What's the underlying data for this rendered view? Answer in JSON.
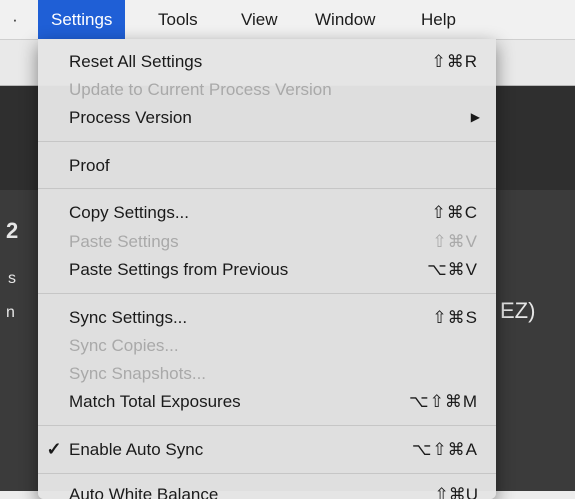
{
  "menubar": {
    "items": [
      {
        "label": "Settings",
        "active": true
      },
      {
        "label": "Tools"
      },
      {
        "label": "View"
      },
      {
        "label": "Window"
      },
      {
        "label": "Help"
      }
    ]
  },
  "background": {
    "frag_a": "2",
    "frag_b": "s",
    "frag_c": "n",
    "frag_d": "EZ)"
  },
  "menu": {
    "items": [
      {
        "label": "Reset All Settings",
        "shortcut": "⇧⌘R",
        "enabled": true
      },
      {
        "label": "Update to Current Process Version",
        "shortcut": "",
        "enabled": false
      },
      {
        "label": "Process Version",
        "submenu": "▶",
        "enabled": true
      },
      {
        "label": "Proof",
        "shortcut": "",
        "enabled": true
      },
      {
        "label": "Copy Settings...",
        "shortcut": "⇧⌘C",
        "enabled": true
      },
      {
        "label": "Paste Settings",
        "shortcut": "⇧⌘V",
        "enabled": false
      },
      {
        "label": "Paste Settings from Previous",
        "shortcut": "⌥⌘V",
        "enabled": true
      },
      {
        "label": "Sync Settings...",
        "shortcut": "⇧⌘S",
        "enabled": true
      },
      {
        "label": "Sync Copies...",
        "shortcut": "",
        "enabled": false
      },
      {
        "label": "Sync Snapshots...",
        "shortcut": "",
        "enabled": false
      },
      {
        "label": "Match Total Exposures",
        "shortcut": "⌥⇧⌘M",
        "enabled": true
      },
      {
        "label": "Enable Auto Sync",
        "shortcut": "⌥⇧⌘A",
        "enabled": true,
        "checked": true,
        "check": "✓"
      }
    ],
    "cutoff_label": "Auto White Balance",
    "cutoff_shortcut": "⇧⌘U"
  },
  "colors": {
    "highlight": "#1f5fd6",
    "menu_bg": "#e4e4e4",
    "disabled_text": "#a9a9a9"
  }
}
